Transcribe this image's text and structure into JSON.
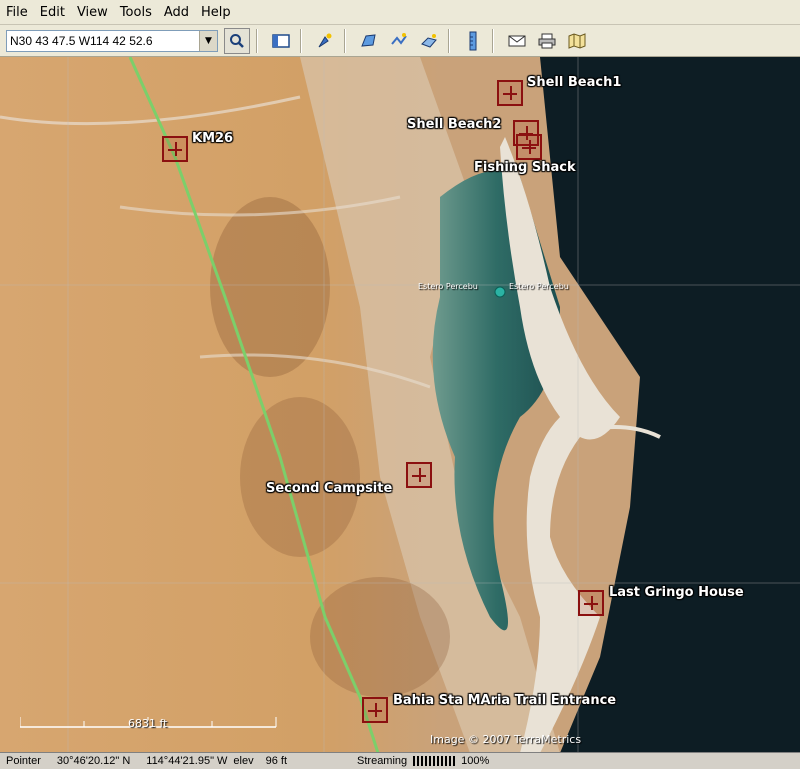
{
  "menu": [
    "File",
    "Edit",
    "View",
    "Tools",
    "Add",
    "Help"
  ],
  "toolbar": {
    "coordinate_value": "N30 43 47.5 W114 42 52.6",
    "icons": [
      "search-icon",
      "sidebar-icon",
      "placemark-icon",
      "polygon-icon",
      "path-icon",
      "image-overlay-icon",
      "ruler-icon",
      "email-icon",
      "print-icon",
      "view-in-maps-icon"
    ]
  },
  "placemarks": [
    {
      "name": "shell-beach1",
      "label": "Shell Beach1"
    },
    {
      "name": "shell-beach2",
      "label": "Shell Beach2"
    },
    {
      "name": "fishing-shack",
      "label": "Fishing Shack"
    },
    {
      "name": "km26",
      "label": "KM26"
    },
    {
      "name": "second-campsite",
      "label": "Second Campsite"
    },
    {
      "name": "last-gringo-house",
      "label": "Last Gringo House"
    },
    {
      "name": "bahia-trail-entrance",
      "label": "Bahia Sta MAria Trail Entrance"
    }
  ],
  "map": {
    "estero_label_left": "Estero Percebu",
    "estero_label_right": "Estero Percebu",
    "scale_label": "6831 ft",
    "copyright": "Image © 2007 TerraMetrics"
  },
  "status": {
    "pointer_label": "Pointer",
    "latitude": "30°46'20.12\" N",
    "longitude": "114°44'21.95\" W",
    "elev_label": "elev",
    "elev_value": "96 ft",
    "streaming_label": "Streaming",
    "streaming_value": "100%"
  },
  "colors": {
    "desert": "#d7a66f",
    "lagoon": "#2f6c66",
    "ocean": "#0c1c22",
    "route": "#7ccf6a",
    "pin": "#8b1010"
  }
}
